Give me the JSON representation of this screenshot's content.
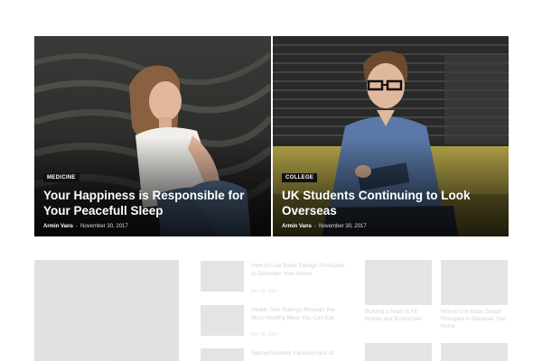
{
  "featured": [
    {
      "category": "MEDICINE",
      "title": "Your Happiness is Responsible for Your Peacefull Sleep",
      "author": "Armin Vans",
      "separator": "-",
      "date": "November 30, 2017"
    },
    {
      "category": "COLLEGE",
      "title": "UK Students Continuing to Look Overseas",
      "author": "Armin Vans",
      "separator": "-",
      "date": "November 30, 2017"
    }
  ],
  "faded_list": [
    {
      "title": "How to Use Basic Design Principles to Decorate Your Home",
      "date": "Nov 30, 2017"
    },
    {
      "title": "Health Star Ratings Reveals the Most Healthy Meal You Can Eat",
      "date": "Nov 30, 2017"
    },
    {
      "title": "Spring/Summer Fashion Mos at"
    }
  ],
  "faded_grid": [
    {
      "title": "Building a Team to Fit Brands and Businesses"
    },
    {
      "title": "How to Use Basic Design Principles to Decorate Your Home"
    }
  ],
  "colors": {
    "overlay": "#000000",
    "badge_bg": "#111111",
    "title_text": "#ffffff"
  }
}
